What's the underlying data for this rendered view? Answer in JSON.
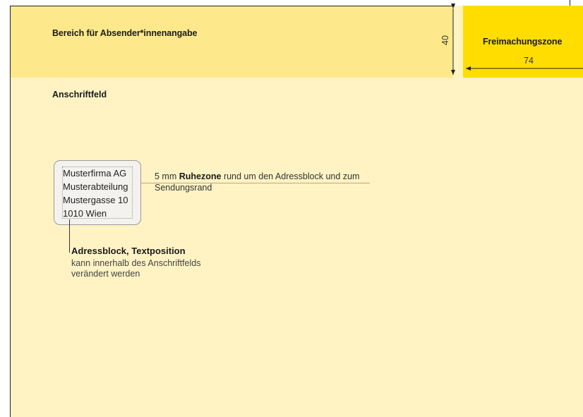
{
  "zones": {
    "sender_label": "Bereich für Absender*innenangabe",
    "postage_label": "Freimachungszone",
    "address_field_label": "Anschriftfeld",
    "dim_height": "40",
    "dim_width": "74"
  },
  "address_block": {
    "lines": [
      "Musterfirma AG",
      "Musterabteilung",
      "Mustergasse 10",
      "1010 Wien"
    ]
  },
  "callouts": {
    "quiet_zone_prefix": "5 mm ",
    "quiet_zone_bold": "Ruhezone",
    "quiet_zone_suffix": " rund um den Adressblock und zum Sendungsrand",
    "text_position_title": "Adressblock, Textposition",
    "text_position_desc": "kann innerhalb des Anschriftfelds verändert werden"
  },
  "colors": {
    "sender_zone": "#fde98b",
    "postage_zone": "#ffdd00",
    "address_zone": "#fff3c4"
  }
}
